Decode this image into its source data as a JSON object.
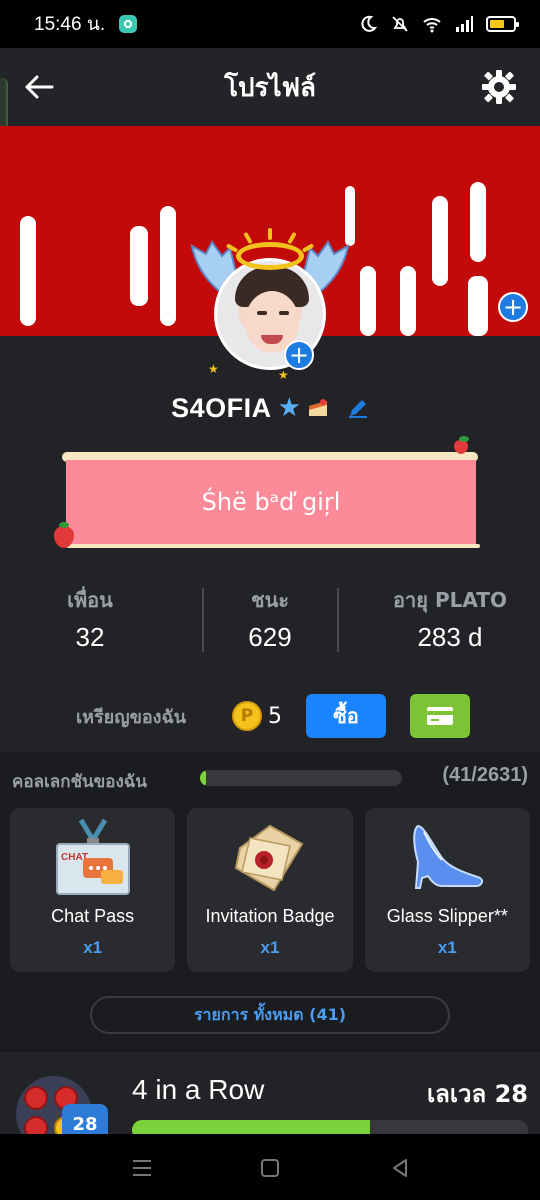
{
  "status_bar": {
    "time": "15:46 น."
  },
  "header": {
    "title": "โปรไฟล์"
  },
  "profile": {
    "username": "S4OFIA",
    "bio": "Śhë bᵃď giŗl"
  },
  "stats": [
    {
      "label": "เพื่อน",
      "value": "32"
    },
    {
      "label": "ชนะ",
      "value": "629"
    },
    {
      "label": "อายุ PLATO",
      "value": "283 d"
    }
  ],
  "coins": {
    "label": "เหรียญของฉัน",
    "coin_symbol": "P",
    "count": "5",
    "buy_label": "ซื้อ"
  },
  "collection": {
    "title": "คอลเลกชันของฉัน",
    "count": "(41/2631)",
    "progress": 0.016,
    "items": [
      {
        "name": "Chat Pass",
        "qty": "x1",
        "icon": "chat-pass-icon"
      },
      {
        "name": "Invitation Badge",
        "qty": "x1",
        "icon": "invitation-badge-icon"
      },
      {
        "name": "Glass Slipper**",
        "qty": "x1",
        "icon": "glass-slipper-icon"
      }
    ],
    "all_label": "รายการ ทั้งหมด (41)"
  },
  "game": {
    "name": "4 in a Row",
    "level": "เลเวล 28",
    "badge_level": "28",
    "progress": 0.6
  },
  "colors": {
    "banner_red": "#c30a0a",
    "accent_blue": "#1a84ff",
    "accent_green": "#7cc436",
    "bio_pink": "#fc8a98"
  }
}
